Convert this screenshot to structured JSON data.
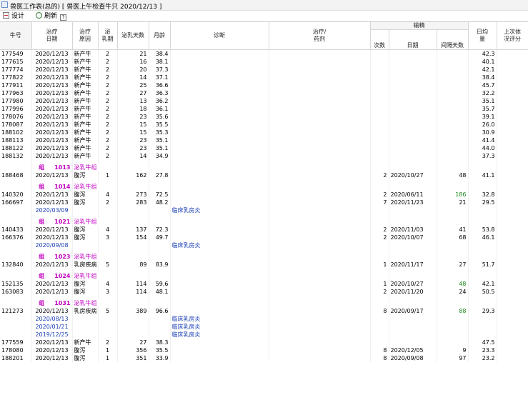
{
  "window": {
    "title": "兽医工作表(总的) [ 兽医上午检查牛只 2020/12/13 ]"
  },
  "toolbar": {
    "design_label": "设计",
    "refresh_label": "刷新",
    "help_label": "?"
  },
  "columns": {
    "cow_no": "牛号",
    "treat_date": "治疗\n日期",
    "treat_reason": "治疗\n原因",
    "lactation": "泌\n乳期",
    "milk_days": "泌乳天数",
    "month_age": "月龄",
    "diagnosis": "诊断",
    "treatment": "治疗/\n药剂",
    "breeding_group": "输精",
    "breed_count": "次数",
    "breed_date": "日期",
    "interval_days": "间隔天数",
    "daily_avg": "日均\n量",
    "last_score": "上次体\n况评分"
  },
  "rows": [
    {
      "type": "data",
      "cow": "177549",
      "date": "2020/12/13",
      "reason": "新产牛",
      "lac": "2",
      "days": "21",
      "age": "38.4",
      "avg": "42.3"
    },
    {
      "type": "data",
      "cow": "177615",
      "date": "2020/12/13",
      "reason": "新产牛",
      "lac": "2",
      "days": "16",
      "age": "38.1",
      "avg": "40.1"
    },
    {
      "type": "data",
      "cow": "177774",
      "date": "2020/12/13",
      "reason": "新产牛",
      "lac": "2",
      "days": "20",
      "age": "37.3",
      "avg": "42.1"
    },
    {
      "type": "data",
      "cow": "177822",
      "date": "2020/12/13",
      "reason": "新产牛",
      "lac": "2",
      "days": "14",
      "age": "37.1",
      "avg": "38.4"
    },
    {
      "type": "data",
      "cow": "177911",
      "date": "2020/12/13",
      "reason": "新产牛",
      "lac": "2",
      "days": "25",
      "age": "36.6",
      "avg": "45.7"
    },
    {
      "type": "data",
      "cow": "177963",
      "date": "2020/12/13",
      "reason": "新产牛",
      "lac": "2",
      "days": "27",
      "age": "36.3",
      "avg": "32.2"
    },
    {
      "type": "data",
      "cow": "177980",
      "date": "2020/12/13",
      "reason": "新产牛",
      "lac": "2",
      "days": "13",
      "age": "36.2",
      "avg": "35.1"
    },
    {
      "type": "data",
      "cow": "177996",
      "date": "2020/12/13",
      "reason": "新产牛",
      "lac": "2",
      "days": "18",
      "age": "36.1",
      "avg": "35.7"
    },
    {
      "type": "data",
      "cow": "178076",
      "date": "2020/12/13",
      "reason": "新产牛",
      "lac": "2",
      "days": "23",
      "age": "35.6",
      "avg": "39.1"
    },
    {
      "type": "data",
      "cow": "178087",
      "date": "2020/12/13",
      "reason": "新产牛",
      "lac": "2",
      "days": "15",
      "age": "35.5",
      "avg": "26.0"
    },
    {
      "type": "data",
      "cow": "188102",
      "date": "2020/12/13",
      "reason": "新产牛",
      "lac": "2",
      "days": "15",
      "age": "35.3",
      "avg": "30.9"
    },
    {
      "type": "data",
      "cow": "188113",
      "date": "2020/12/13",
      "reason": "新产牛",
      "lac": "2",
      "days": "23",
      "age": "35.1",
      "avg": "41.4"
    },
    {
      "type": "data",
      "cow": "188122",
      "date": "2020/12/13",
      "reason": "新产牛",
      "lac": "2",
      "days": "23",
      "age": "35.1",
      "avg": "44.0"
    },
    {
      "type": "data",
      "cow": "188132",
      "date": "2020/12/13",
      "reason": "新产牛",
      "lac": "2",
      "days": "14",
      "age": "34.9",
      "avg": "37.3"
    },
    {
      "type": "spacer"
    },
    {
      "type": "group",
      "label": "组",
      "num": "1013",
      "name": "泌乳牛组"
    },
    {
      "type": "data",
      "cow": "188468",
      "date": "2020/12/13",
      "reason": "腹泻",
      "lac": "1",
      "days": "162",
      "age": "27.8",
      "bcount": "2",
      "bdate": "2020/10/27",
      "interval": "48",
      "avg": "41.1"
    },
    {
      "type": "spacer"
    },
    {
      "type": "group",
      "label": "组",
      "num": "1014",
      "name": "泌乳牛组"
    },
    {
      "type": "data",
      "cow": "140320",
      "date": "2020/12/13",
      "reason": "腹泻",
      "lac": "4",
      "days": "273",
      "age": "72.5",
      "bcount": "2",
      "bdate": "2020/06/11",
      "interval": "186",
      "interval_green": true,
      "avg": "32.8"
    },
    {
      "type": "data",
      "cow": "166697",
      "date": "2020/12/13",
      "reason": "腹泻",
      "lac": "2",
      "days": "283",
      "age": "48.2",
      "bcount": "7",
      "bdate": "2020/11/23",
      "interval": "21",
      "avg": "29.5"
    },
    {
      "type": "sub",
      "date": "2020/03/09",
      "diag": "临床乳房炎"
    },
    {
      "type": "spacer"
    },
    {
      "type": "group",
      "label": "组",
      "num": "1021",
      "name": "泌乳牛组"
    },
    {
      "type": "data",
      "cow": "140433",
      "date": "2020/12/13",
      "reason": "腹泻",
      "lac": "4",
      "days": "137",
      "age": "72.3",
      "bcount": "2",
      "bdate": "2020/11/03",
      "interval": "41",
      "avg": "53.8"
    },
    {
      "type": "data",
      "cow": "166376",
      "date": "2020/12/13",
      "reason": "腹泻",
      "lac": "3",
      "days": "154",
      "age": "49.7",
      "bcount": "2",
      "bdate": "2020/10/07",
      "interval": "68",
      "avg": "46.1"
    },
    {
      "type": "sub",
      "date": "2020/09/08",
      "diag": "临床乳房炎"
    },
    {
      "type": "spacer"
    },
    {
      "type": "group",
      "label": "组",
      "num": "1023",
      "name": "泌乳牛组"
    },
    {
      "type": "data",
      "cow": "132840",
      "date": "2020/12/13",
      "reason": "乳房疾病",
      "lac": "5",
      "days": "89",
      "age": "83.9",
      "bcount": "1",
      "bdate": "2020/11/17",
      "interval": "27",
      "avg": "51.7"
    },
    {
      "type": "spacer"
    },
    {
      "type": "group",
      "label": "组",
      "num": "1024",
      "name": "泌乳牛组"
    },
    {
      "type": "data",
      "cow": "152135",
      "date": "2020/12/13",
      "reason": "腹泻",
      "lac": "4",
      "days": "114",
      "age": "59.6",
      "bcount": "1",
      "bdate": "2020/10/27",
      "interval": "48",
      "interval_green": true,
      "avg": "42.1"
    },
    {
      "type": "data",
      "cow": "163083",
      "date": "2020/12/13",
      "reason": "腹泻",
      "lac": "3",
      "days": "114",
      "age": "48.1",
      "bcount": "2",
      "bdate": "2020/11/20",
      "interval": "24",
      "avg": "50.5"
    },
    {
      "type": "spacer"
    },
    {
      "type": "group",
      "label": "组",
      "num": "1031",
      "name": "泌乳牛组"
    },
    {
      "type": "data",
      "cow": "121273",
      "date": "2020/12/13",
      "reason": "乳房疾病",
      "lac": "5",
      "days": "389",
      "age": "96.6",
      "bcount": "8",
      "bdate": "2020/09/17",
      "interval": "88",
      "interval_green": true,
      "avg": "29.3"
    },
    {
      "type": "sub",
      "date": "2020/08/13",
      "diag": "临床乳房炎"
    },
    {
      "type": "sub",
      "date": "2020/01/21",
      "diag": "临床乳房炎"
    },
    {
      "type": "sub",
      "date": "2019/12/25",
      "diag": "临床乳房炎"
    },
    {
      "type": "data",
      "cow": "177559",
      "date": "2020/12/13",
      "reason": "新产牛",
      "lac": "2",
      "days": "27",
      "age": "38.3",
      "avg": "47.5"
    },
    {
      "type": "data",
      "cow": "178080",
      "date": "2020/12/13",
      "reason": "腹泻",
      "lac": "1",
      "days": "356",
      "age": "35.5",
      "bcount": "8",
      "bdate": "2020/12/05",
      "interval": "9",
      "avg": "23.3"
    },
    {
      "type": "data",
      "cow": "188201",
      "date": "2020/12/13",
      "reason": "腹泻",
      "lac": "1",
      "days": "351",
      "age": "33.9",
      "bcount": "8",
      "bdate": "2020/09/08",
      "interval": "97",
      "avg": "23.2"
    }
  ]
}
